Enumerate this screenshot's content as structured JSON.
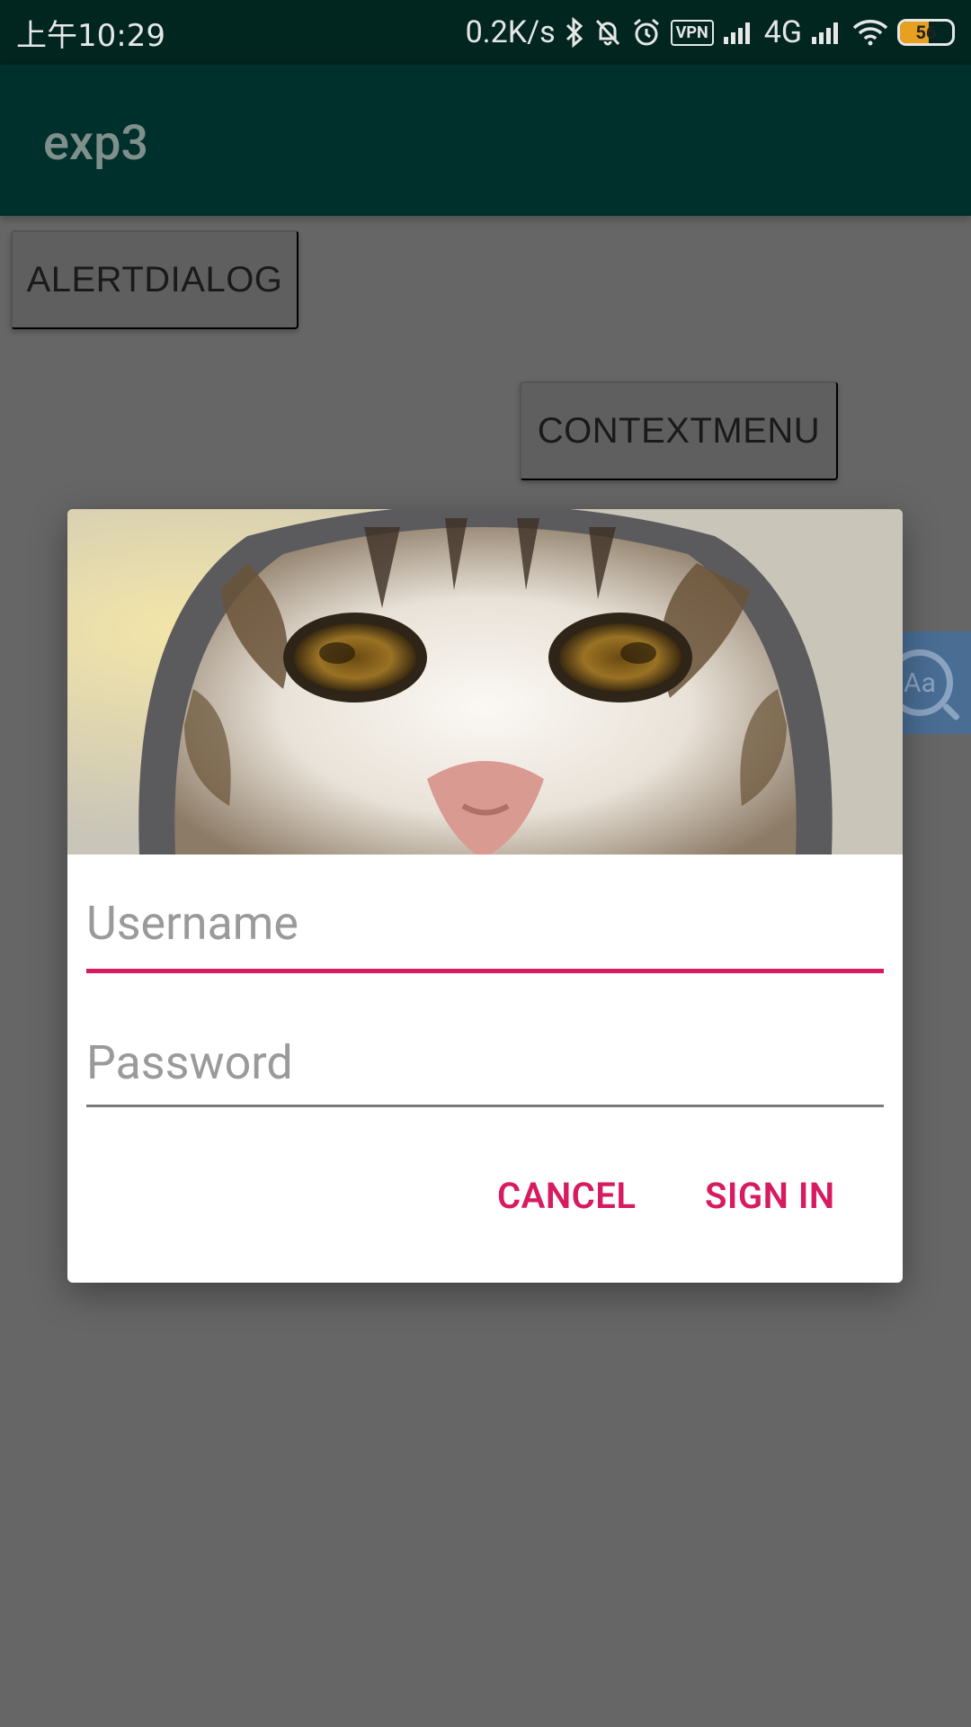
{
  "status_bar": {
    "time": "上午10:29",
    "network_speed": "0.2K/s",
    "icons": [
      "bluetooth-icon",
      "bell-muted-icon",
      "alarm-icon",
      "vpn-icon",
      "signal-icon",
      "signal-icon",
      "wifi-icon",
      "battery-icon"
    ],
    "vpn_label": "VPN",
    "network_type": "4G",
    "battery_level": "56"
  },
  "app_bar": {
    "title": "exp3"
  },
  "background_buttons": {
    "alertdialog": "ALERTDIALOG",
    "contextmenu": "CONTEXTMENU"
  },
  "floating_bubble": {
    "label": "Aa"
  },
  "dialog": {
    "image": "cat-photo",
    "username": {
      "value": "",
      "placeholder": "Username"
    },
    "password": {
      "value": "",
      "placeholder": "Password"
    },
    "cancel_label": "CANCEL",
    "signin_label": "SIGN IN",
    "accent_color": "#d81b60"
  }
}
